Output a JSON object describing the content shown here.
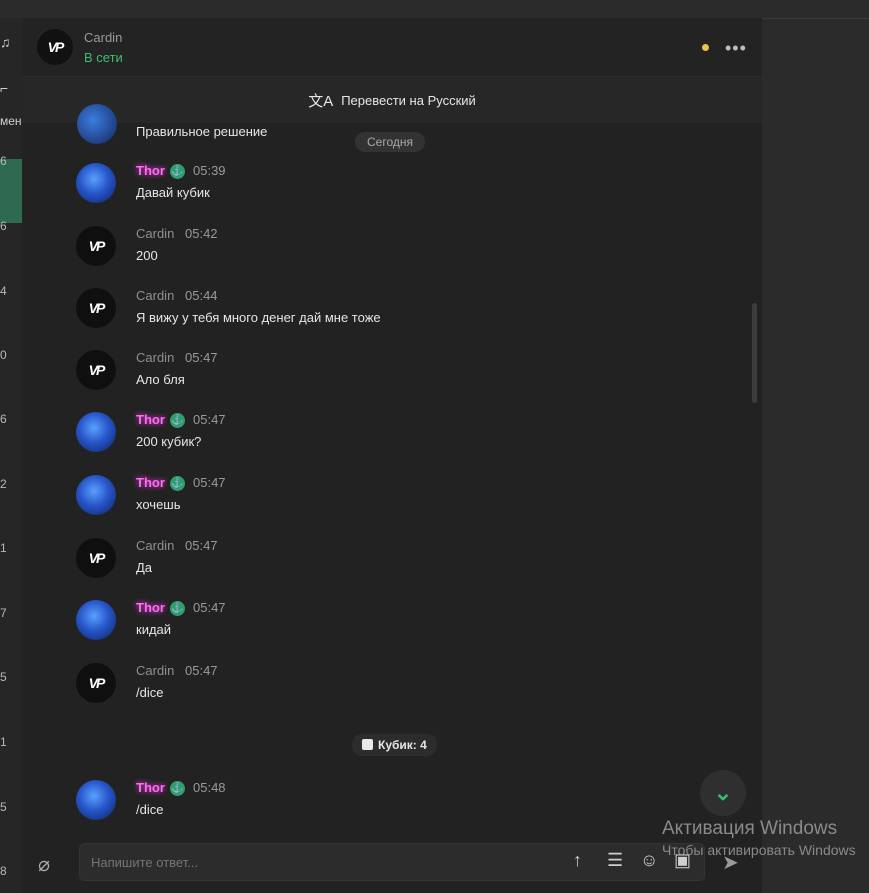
{
  "header": {
    "name": "Cardin",
    "status": "В сети"
  },
  "translate": {
    "label": "Перевести на Русский"
  },
  "sidebar": {
    "partial_label": "мени",
    "counts": [
      "6",
      "6",
      "4",
      "0",
      "6",
      "2",
      "1",
      "7",
      "5",
      "1",
      "5",
      "8"
    ]
  },
  "chat": {
    "previous_message": "Правильное решение",
    "date_separator": "Сегодня",
    "messages": [
      {
        "author": "Thor",
        "time": "05:39",
        "text": "Давай кубик"
      },
      {
        "author": "Cardin",
        "time": "05:42",
        "text": "200"
      },
      {
        "author": "Cardin",
        "time": "05:44",
        "text": "Я вижу у тебя много денег дай мне тоже"
      },
      {
        "author": "Cardin",
        "time": "05:47",
        "text": "Ало бля"
      },
      {
        "author": "Thor",
        "time": "05:47",
        "text": "200 кубик?"
      },
      {
        "author": "Thor",
        "time": "05:47",
        "text": "хочешь"
      },
      {
        "author": "Cardin",
        "time": "05:47",
        "text": "Да"
      },
      {
        "author": "Thor",
        "time": "05:47",
        "text": "кидай"
      },
      {
        "author": "Cardin",
        "time": "05:47",
        "text": "/dice"
      },
      {
        "author": "Thor",
        "time": "05:48",
        "text": "/dice"
      }
    ],
    "dice_result": "Кубик: 4"
  },
  "composer": {
    "placeholder": "Напишите ответ..."
  },
  "watermark": {
    "title": "Активация Windows",
    "subtitle": "Чтобы активировать Windows"
  },
  "colors": {
    "online_green": "#3fbf6b",
    "thor_name": "#ff6bf5",
    "status_dot": "#f0c04a",
    "badge_green": "#2f9e6e"
  },
  "icons": [
    "headphones-icon",
    "translate-icon",
    "more-icon",
    "attach-icon",
    "arrow-up-icon",
    "list-icon",
    "emoji-icon",
    "image-icon",
    "send-icon",
    "chevron-down-icon",
    "dice-icon"
  ]
}
